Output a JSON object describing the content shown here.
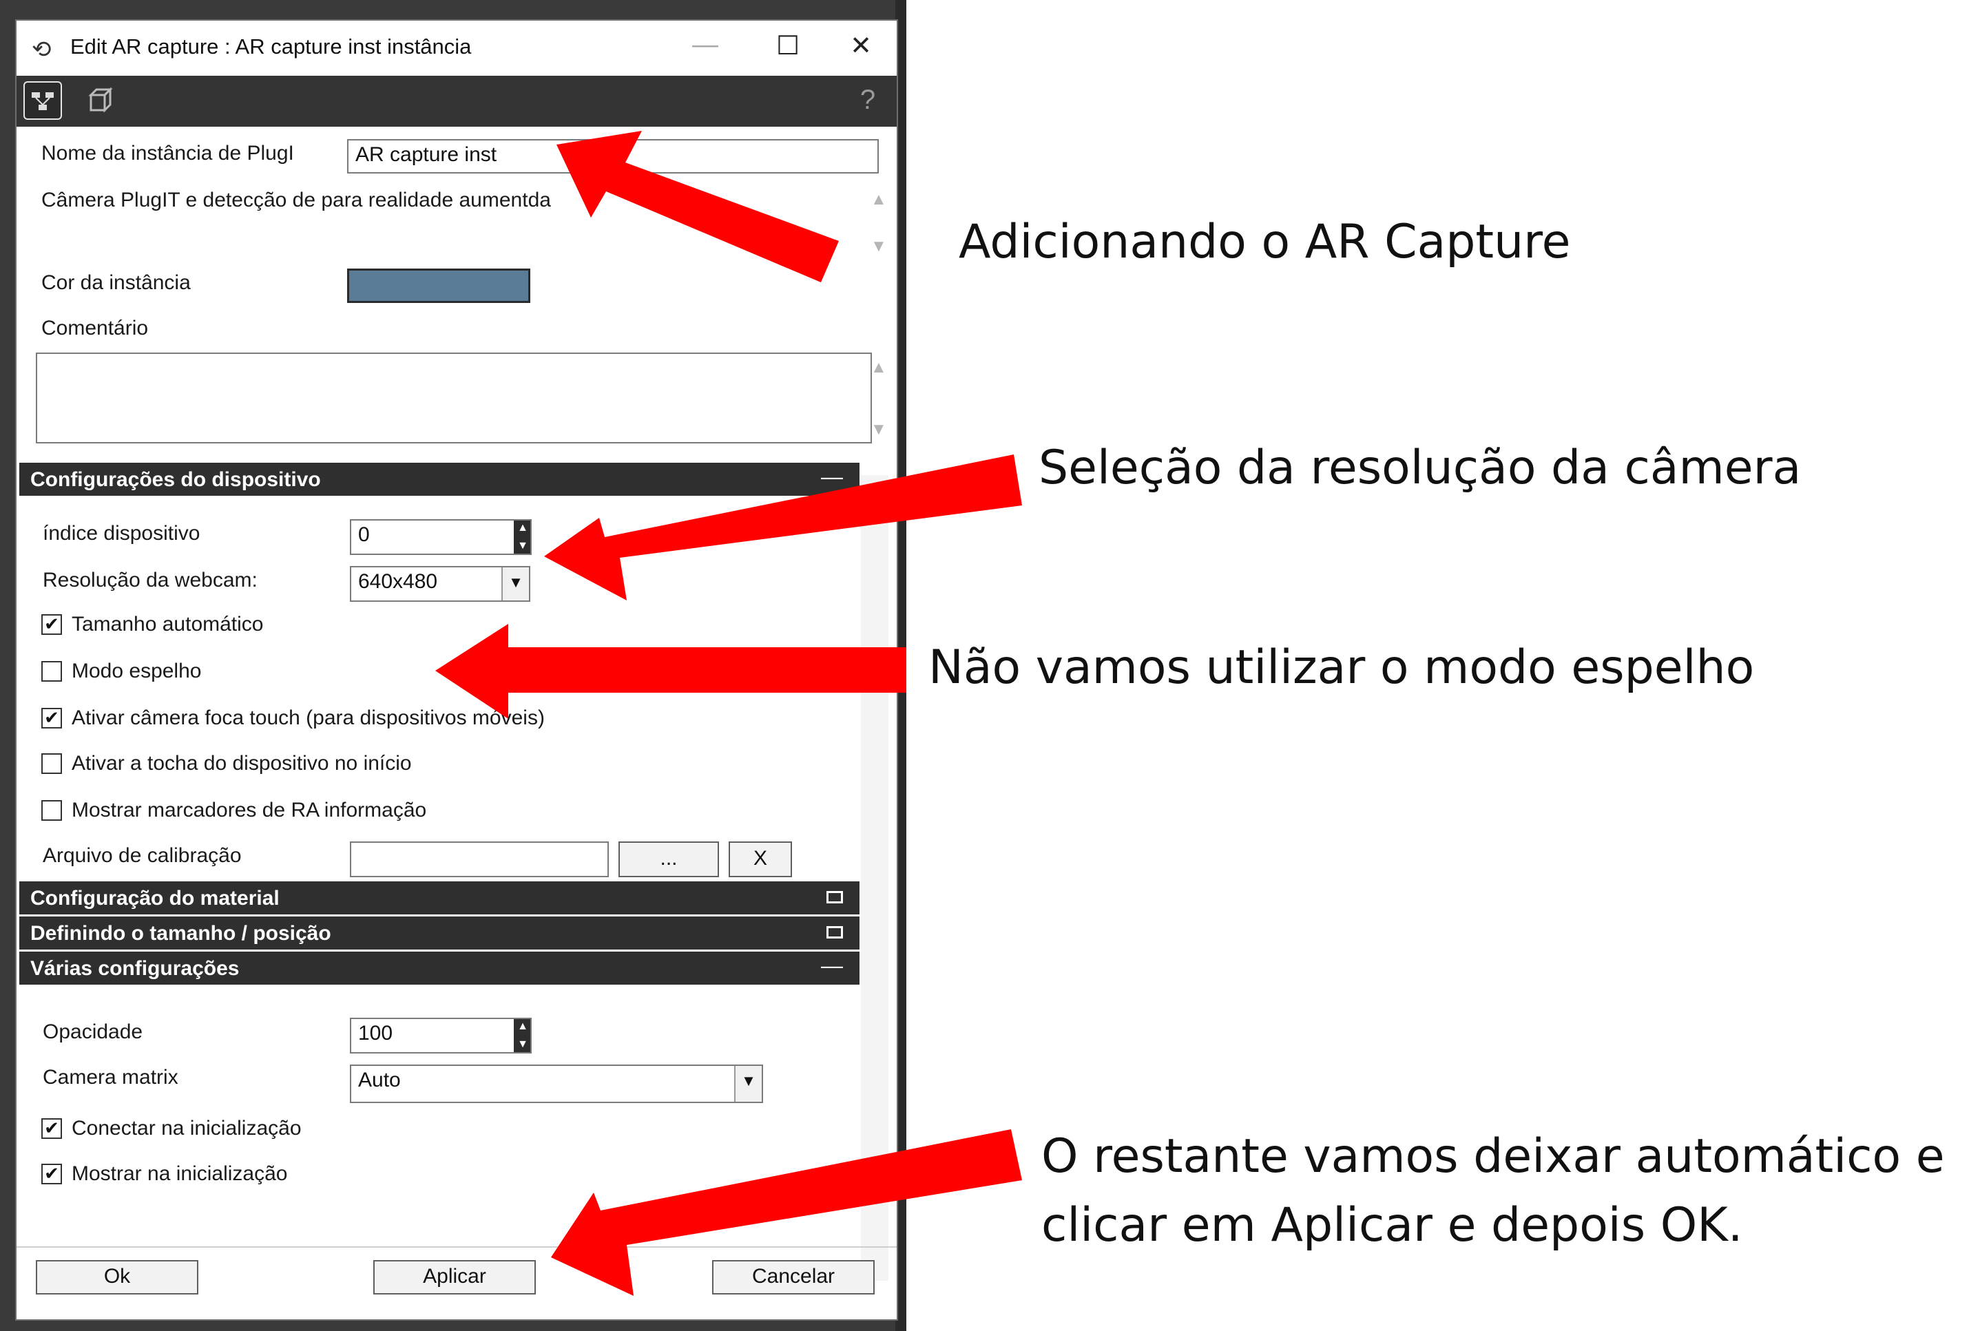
{
  "window": {
    "title": "Edit AR capture : AR capture inst instância",
    "minimize_glyph": "—",
    "maximize_glyph": "☐",
    "close_glyph": "✕"
  },
  "toolbar": {
    "icons": [
      "graph-icon",
      "box-icon",
      "help-icon"
    ],
    "help_glyph": "?"
  },
  "general": {
    "instance_name_label": "Nome da instância de PlugI",
    "instance_name_value": "AR capture inst",
    "description": "Câmera PlugIT e detecção de para realidade aument",
    "description_tail": "da",
    "color_label": "Cor da instância",
    "color_value": "#5b7c96",
    "comment_label": "Comentário",
    "comment_value": ""
  },
  "device_section": {
    "title": "Configurações do dispositivo",
    "toggle": "—",
    "device_index_label": "índice dispositivo",
    "device_index_value": "0",
    "webcam_res_label": "Resolução da webcam:",
    "webcam_res_value": "640x480",
    "checkboxes": [
      {
        "label": "Tamanho automático",
        "checked": true,
        "mark": "✔"
      },
      {
        "label": "Modo espelho",
        "checked": false,
        "mark": ""
      },
      {
        "label": "Ativar câmera foca touch (para dispositivos móveis)",
        "checked": true,
        "mark": "✔"
      },
      {
        "label": "Ativar a tocha do dispositivo no início",
        "checked": false,
        "mark": ""
      },
      {
        "label": "Mostrar marcadores de RA informação",
        "checked": false,
        "mark": ""
      }
    ],
    "calibration_label": "Arquivo de calibração",
    "calibration_value": "",
    "browse_label": "...",
    "clear_label": "X"
  },
  "collapsed_sections": [
    {
      "title": "Configuração do material"
    },
    {
      "title": "Definindo o tamanho / posição"
    }
  ],
  "misc_section": {
    "title": "Várias configurações",
    "toggle": "—",
    "opacity_label": "Opacidade",
    "opacity_value": "100",
    "camera_matrix_label": "Camera matrix",
    "camera_matrix_value": "Auto",
    "checkboxes": [
      {
        "label": "Conectar na inicialização",
        "checked": true,
        "mark": "✔"
      },
      {
        "label": "Mostrar na inicialização",
        "checked": true,
        "mark": "✔"
      }
    ]
  },
  "buttons": {
    "ok": "Ok",
    "apply": "Aplicar",
    "cancel": "Cancelar"
  },
  "annotations": {
    "a1": "Adicionando o AR Capture",
    "a2": "Seleção da resolução da câmera",
    "a3": "Não vamos utilizar o modo espelho",
    "a4_line1": "O restante vamos deixar automático e",
    "a4_line2": "clicar em Aplicar e depois OK.",
    "arrow_color": "#ff0000"
  }
}
